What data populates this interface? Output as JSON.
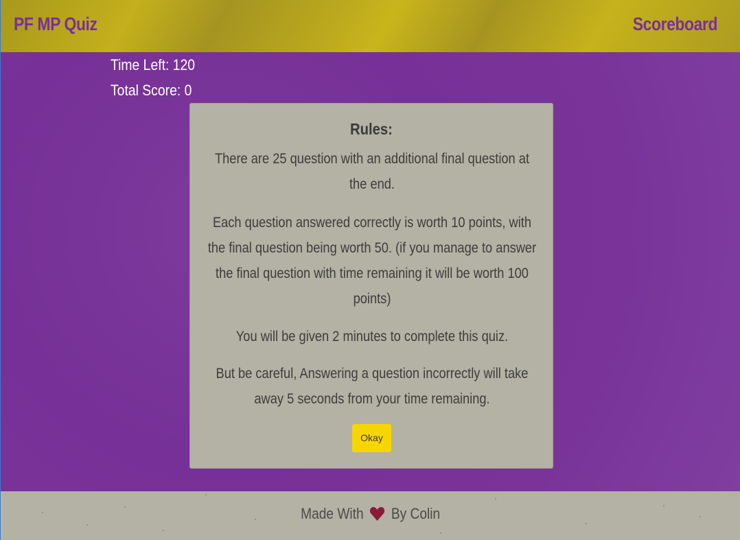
{
  "header": {
    "brand": "PF MP Quiz",
    "scoreboard_link": "Scoreboard"
  },
  "stats": {
    "time_left": "Time Left: 120",
    "total_score": "Total Score: 0"
  },
  "modal": {
    "title": "Rules:",
    "rules": [
      "There are 25 question with an additional final question at the end.",
      "Each question answered correctly is worth 10 points, with the final question being worth 50. (if you manage to answer the final question with time remaining it will be worth 100 points)",
      "You will be given 2 minutes to complete this quiz.",
      "But be careful, Answering a question incorrectly will take away 5 seconds from your time remaining."
    ],
    "okay_label": "Okay"
  },
  "footer": {
    "made_with": "Made With",
    "by": "By Colin",
    "heart_icon": "heart-icon"
  },
  "colors": {
    "header_bg": "#b8a61e",
    "brand_text": "#7a2f98",
    "main_bg": "#7a2f98",
    "modal_bg": "#b4b2a5",
    "okay_bg": "#f7d600",
    "footer_bg": "#b4b2a5",
    "heart": "#8b1a3a"
  }
}
